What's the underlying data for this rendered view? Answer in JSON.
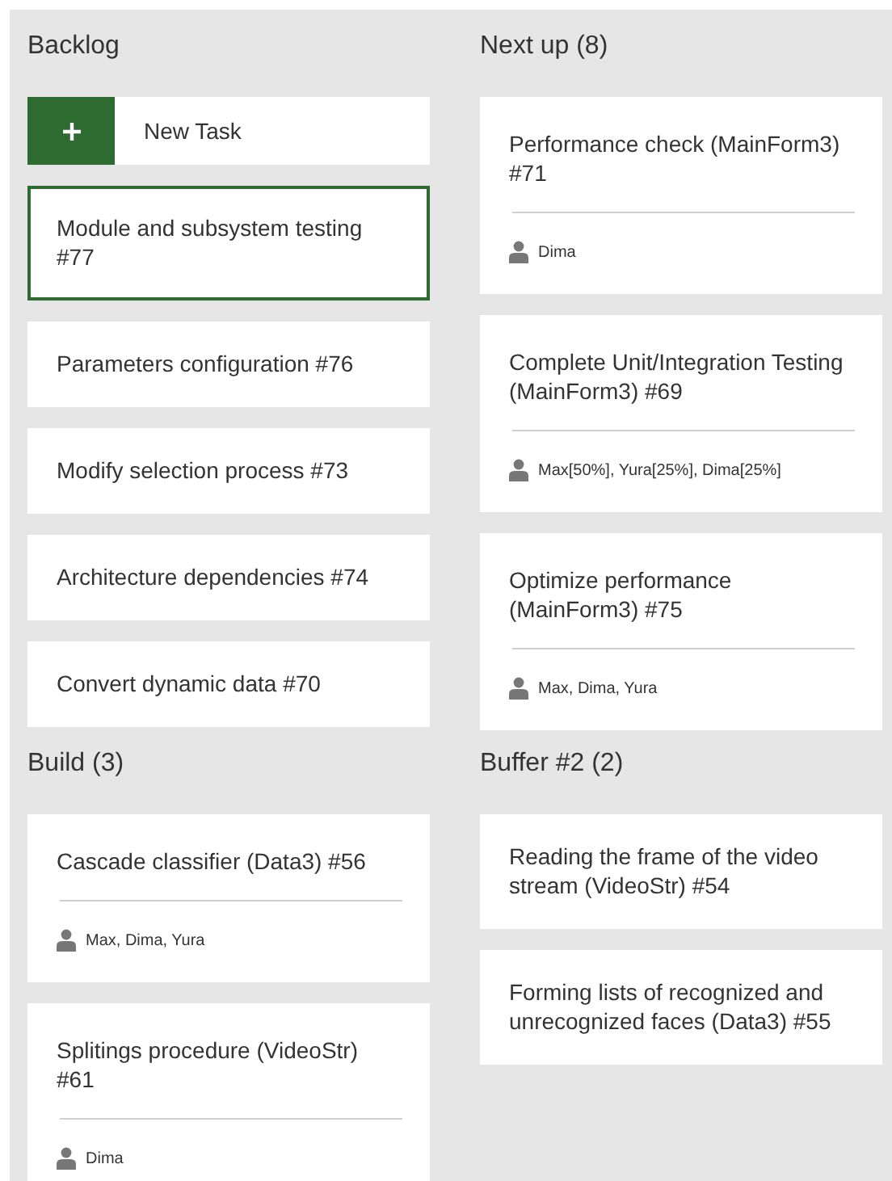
{
  "columns": [
    {
      "title": "Backlog",
      "new_task_button": {
        "label": "New Task"
      },
      "cards": [
        {
          "title": "Module and subsystem testing #77",
          "selected": true
        },
        {
          "title": "Parameters configuration #76",
          "selected": false
        },
        {
          "title": "Modify selection process #73",
          "selected": false
        },
        {
          "title": "Architecture dependencies #74",
          "selected": false
        },
        {
          "title": "Convert dynamic data #70",
          "selected": false
        }
      ]
    },
    {
      "title": "Next up (8)",
      "cards": [
        {
          "title": "Performance check (MainForm3) #71",
          "assignees": "Dima",
          "selected": false
        },
        {
          "title": "Complete Unit/Integration Testing (MainForm3) #69",
          "assignees": "Max[50%], Yura[25%], Dima[25%]",
          "selected": false
        },
        {
          "title": "Optimize performance (MainForm3) #75",
          "assignees": "Max, Dima, Yura",
          "selected": false
        }
      ]
    },
    {
      "title": "Build (3)",
      "cards": [
        {
          "title": "Cascade classifier (Data3) #56",
          "assignees": "Max, Dima, Yura",
          "selected": false
        },
        {
          "title": "Splitings procedure (VideoStr) #61",
          "assignees": "Dima",
          "selected": false
        }
      ]
    },
    {
      "title": "Buffer #2 (2)",
      "cards": [
        {
          "title": "Reading the frame of the video stream (VideoStr) #54",
          "selected": false
        },
        {
          "title": "Forming lists of recognized and unrecognized faces (Data3) #55",
          "selected": false
        }
      ]
    }
  ]
}
